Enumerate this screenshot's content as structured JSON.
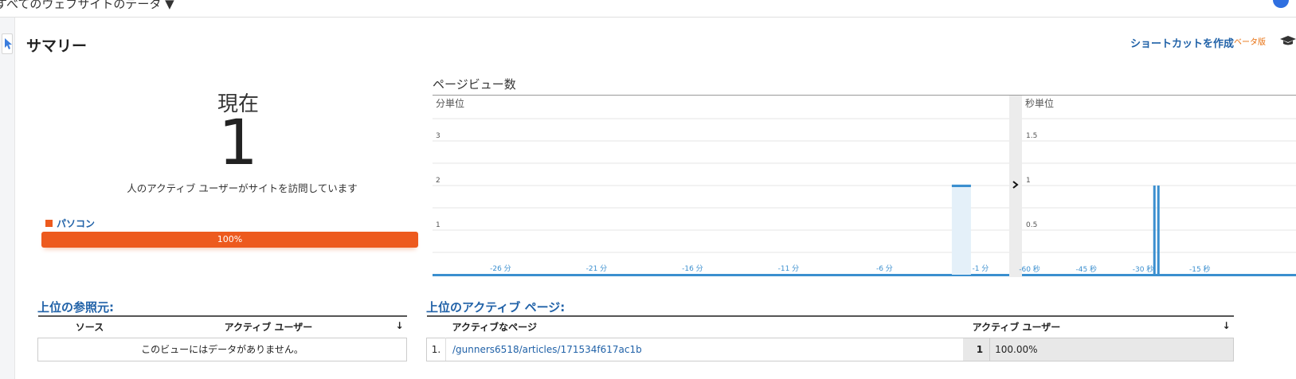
{
  "header": {
    "breadcrumb": "すべてのウェブサイトのデータ ▼"
  },
  "summary": {
    "title": "サマリー",
    "shortcut_label": "ショートカットを作成",
    "beta_label": "ベータ版"
  },
  "active": {
    "now_label": "現在",
    "count": "1",
    "description": "人のアクティブ ユーザーがサイトを訪問しています"
  },
  "devices": [
    {
      "name": "パソコン",
      "share": 1.0,
      "label": "100%",
      "color": "#ed5a1e"
    }
  ],
  "pageviews": {
    "title": "ページビュー数",
    "minute_panel": {
      "label": "分単位",
      "y_ticks": [
        "1",
        "2",
        "3"
      ],
      "x_ticks": [
        "-26 分",
        "-21 分",
        "-16 分",
        "-11 分",
        "-6 分",
        "-1 分"
      ],
      "ylim": [
        0,
        3.5
      ],
      "bars": [
        {
          "minute": -1,
          "value": 2
        }
      ]
    },
    "second_panel": {
      "label": "秒単位",
      "y_ticks": [
        "0.5",
        "1",
        "1.5"
      ],
      "x_ticks": [
        "-60 秒",
        "-45 秒",
        "-30 秒",
        "-15 秒"
      ],
      "ylim": [
        0,
        1.75
      ],
      "bars": [
        {
          "second": -29,
          "value": 1
        }
      ]
    },
    "color": "#3b8fcf"
  },
  "referrers": {
    "title": "上位の参照元:",
    "columns": [
      "ソース",
      "アクティブ ユーザー"
    ],
    "empty_text": "このビューにはデータがありません。"
  },
  "active_pages": {
    "title": "上位のアクティブ ページ:",
    "columns": [
      "アクティブなページ",
      "アクティブ ユーザー"
    ],
    "rows": [
      {
        "rank": "1.",
        "path": "/gunners6518/articles/171534f617ac1b",
        "users": "1",
        "percent": "100.00%"
      }
    ]
  }
}
